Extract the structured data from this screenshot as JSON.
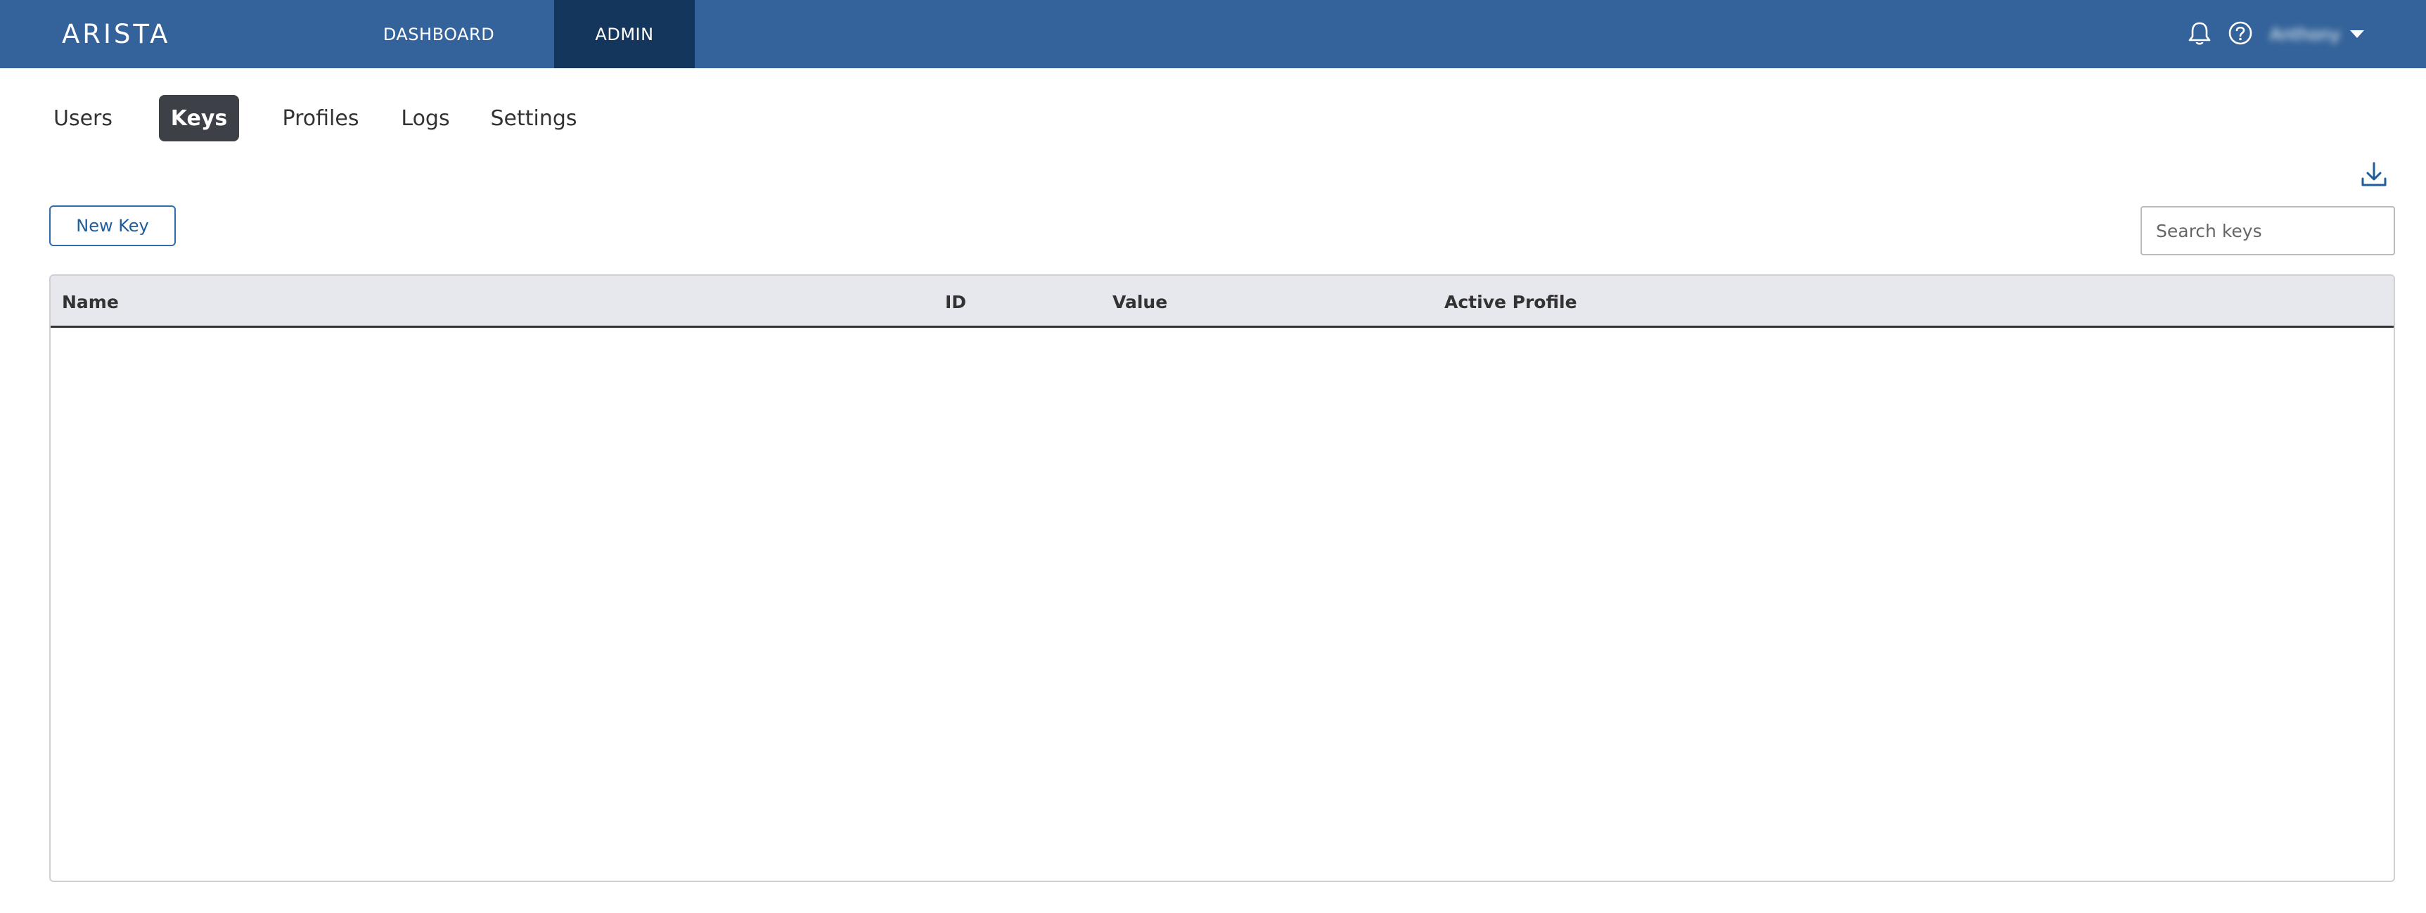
{
  "header": {
    "logo": "ARISTA",
    "nav": [
      {
        "label": "DASHBOARD"
      },
      {
        "label": "ADMIN",
        "active": true
      }
    ],
    "icons": [
      "bell-icon",
      "help-icon"
    ],
    "user": {
      "name": "Anthony"
    },
    "colors": {
      "bar": "#33639a",
      "active": "#15365c"
    }
  },
  "tabs": [
    {
      "label": "Users"
    },
    {
      "label": "Keys",
      "active": true
    },
    {
      "label": "Profiles"
    },
    {
      "label": "Logs"
    },
    {
      "label": "Settings"
    }
  ],
  "toolbar": {
    "new_key_label": "New Key",
    "search_placeholder": "Search keys",
    "download_icon": "download-icon"
  },
  "table": {
    "columns": [
      "Name",
      "ID",
      "Value",
      "Active Profile"
    ],
    "rows": []
  }
}
